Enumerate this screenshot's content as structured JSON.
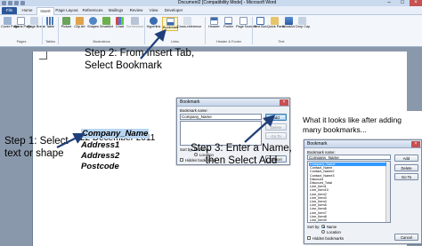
{
  "window": {
    "title": "Document2 [Compatibility Mode] - Microsoft Word",
    "controls": [
      "–",
      "□",
      "×"
    ]
  },
  "tabs": [
    "File",
    "Home",
    "Insert",
    "Page Layout",
    "References",
    "Mailings",
    "Review",
    "View",
    "Developer"
  ],
  "ribbon": {
    "buttons": [
      {
        "label": "Cover Page",
        "icon": "cover-page-icon"
      },
      {
        "label": "Blank Page",
        "icon": "blank-page-icon"
      },
      {
        "label": "Page Break",
        "icon": "page-break-icon"
      },
      {
        "label": "Table",
        "icon": "table-icon"
      },
      {
        "label": "Picture",
        "icon": "picture-icon"
      },
      {
        "label": "Clip Art",
        "icon": "clip-art-icon"
      },
      {
        "label": "Shapes",
        "icon": "shapes-icon"
      },
      {
        "label": "SmartArt",
        "icon": "smartart-icon"
      },
      {
        "label": "Chart",
        "icon": "chart-icon"
      },
      {
        "label": "Screenshot",
        "icon": "screenshot-icon"
      },
      {
        "label": "Hyperlink",
        "icon": "hyperlink-icon"
      },
      {
        "label": "Bookmark",
        "icon": "bookmark-icon"
      },
      {
        "label": "Cross-reference",
        "icon": "cross-reference-icon"
      },
      {
        "label": "Header",
        "icon": "header-icon"
      },
      {
        "label": "Footer",
        "icon": "footer-icon"
      },
      {
        "label": "Page Number",
        "icon": "page-number-icon"
      },
      {
        "label": "Text Box",
        "icon": "text-box-icon"
      },
      {
        "label": "Quick Parts",
        "icon": "quick-parts-icon"
      },
      {
        "label": "WordArt",
        "icon": "wordart-icon"
      },
      {
        "label": "Drop Cap",
        "icon": "drop-cap-icon"
      }
    ],
    "groups": [
      "Pages",
      "Tables",
      "Illustrations",
      "Links",
      "Header & Footer",
      "Text"
    ]
  },
  "document": {
    "date": "22 December 2011",
    "company_name": "Company_Name",
    "address1": "Address1",
    "address2": "Address2",
    "postcode": "Postcode"
  },
  "annotations": {
    "step1": "Step 1:  Select text or shape",
    "step2": "Step 2:  From Insert Tab, Select Bookmark",
    "step3": "Step 3: Enter a Name, then Select Add",
    "after_note": "What it looks like after adding many bookmarks..."
  },
  "dialog1": {
    "title": "Bookmark",
    "name_label": "Bookmark name:",
    "name_value": "Company_Name",
    "add": "Add",
    "delete": "Delete",
    "goto": "Go To",
    "sort_by": "Sort by:",
    "sort_name": "Name",
    "sort_location": "Location",
    "hidden": "Hidden bookmarks",
    "cancel": "Cancel"
  },
  "dialog2": {
    "title": "Bookmark",
    "name_label": "Bookmark name:",
    "name_value": "Company_Name",
    "add": "Add",
    "delete": "Delete",
    "goto": "Go To",
    "sort_by": "Sort by:",
    "sort_name": "Name",
    "sort_location": "Location",
    "hidden": "Hidden bookmarks",
    "cancel": "Cancel",
    "items": [
      "Company_Name",
      "Contact_Name",
      "Contact_Name2",
      "Contact_Name3",
      "Discount",
      "Discount_Total",
      "Line_Item1",
      "Line_Item10",
      "Line_Item2",
      "Line_Item3",
      "Line_Item4",
      "Line_Item5",
      "Line_Item6",
      "Line_Item7",
      "Line_Item8",
      "Line_Item9"
    ],
    "selected_index": 0
  },
  "colors": {
    "ribbon_blue": "#2b579a",
    "arrow": "#1f3f7a",
    "selection": "#3399ff"
  }
}
